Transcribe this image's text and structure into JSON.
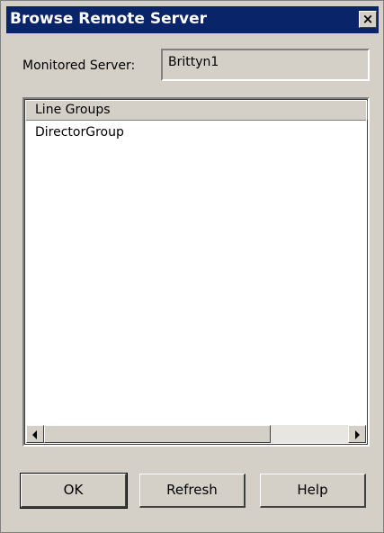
{
  "window": {
    "title": "Browse Remote Server",
    "close_glyph": "×"
  },
  "server": {
    "label": "Monitored Server:",
    "value": "Brittyn1"
  },
  "list": {
    "column_header": "Line Groups",
    "items": [
      "DirectorGroup"
    ]
  },
  "buttons": {
    "ok": "OK",
    "refresh": "Refresh",
    "help": "Help"
  },
  "icons": {
    "close": "close-icon",
    "scroll_left": "arrow-left-icon",
    "scroll_right": "arrow-right-icon"
  }
}
